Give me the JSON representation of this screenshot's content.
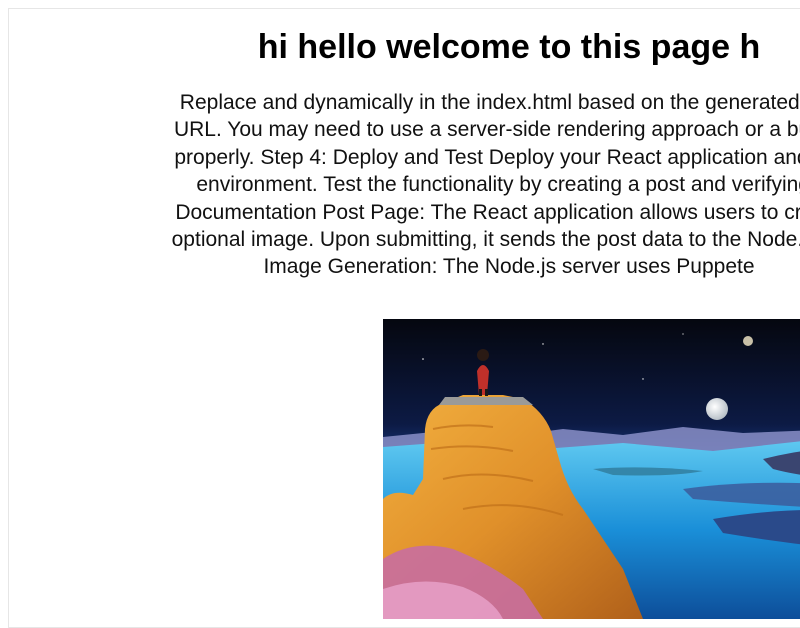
{
  "page": {
    "title": "hi hello welcome to this page h",
    "description_lines": [
      "Replace and dynamically in the index.html based on the generated OG",
      "URL. You may need to use a server-side rendering approach or a build-t",
      "properly. Step 4: Deploy and Test Deploy your React application and the",
      "environment. Test the functionality by creating a post and verifying t",
      "Documentation Post Page: The React application allows users to create",
      "optional image. Upon submitting, it sends the post data to the Node.js se",
      "Image Generation: The Node.js server uses Puppete"
    ]
  },
  "hero_image": {
    "subject": "cloaked-figure-on-cliff-over-alien-sea",
    "colors": {
      "sky_top": "#05070f",
      "sky_mid": "#1a3a8a",
      "horizon": "#f0c080",
      "sea": "#1a8fd8",
      "cliff": "#e0902a",
      "cloak": "#c0302a"
    }
  }
}
